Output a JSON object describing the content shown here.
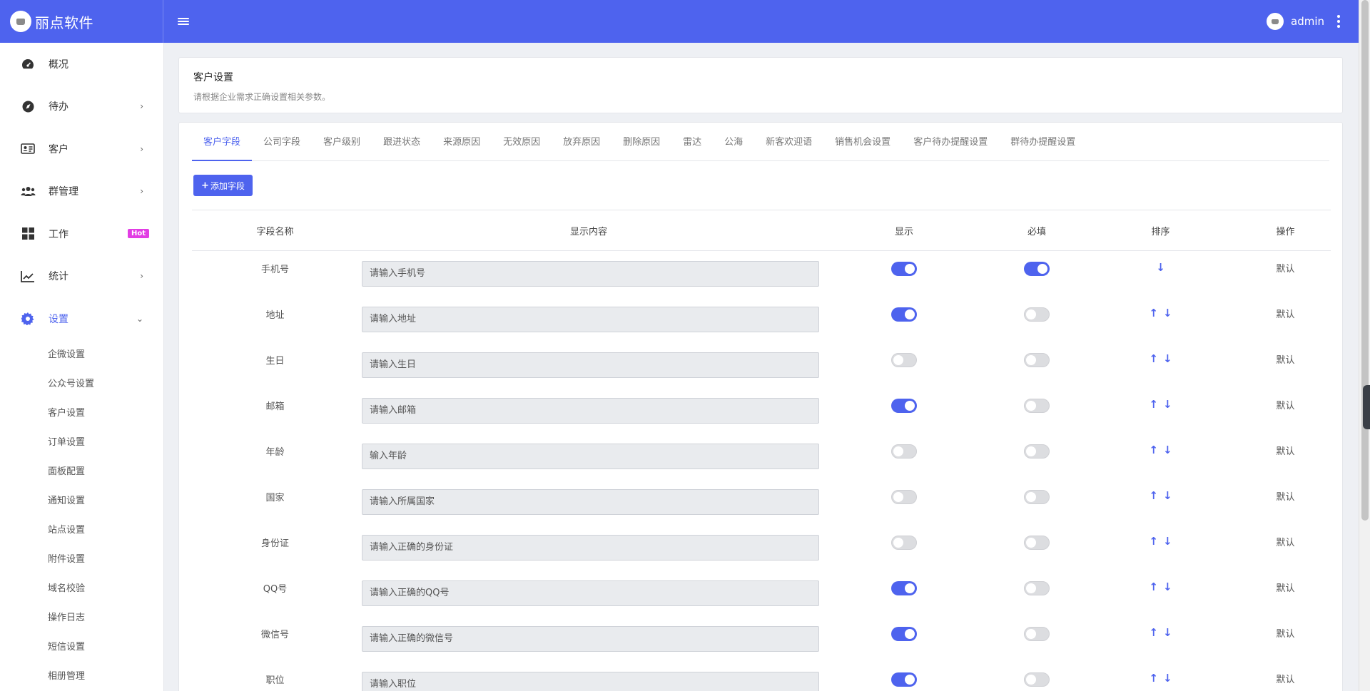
{
  "app": {
    "brand": "丽点软件",
    "username": "admin"
  },
  "colors": {
    "primary": "#4e63ee",
    "hot_badge": "#e23de4"
  },
  "sidebar": {
    "items": [
      {
        "label": "概况",
        "icon": "dashboard-gauge-icon"
      },
      {
        "label": "待办",
        "icon": "compass-icon",
        "arrow": "›"
      },
      {
        "label": "客户",
        "icon": "id-card-icon",
        "arrow": "›"
      },
      {
        "label": "群管理",
        "icon": "users-group-icon",
        "arrow": "›"
      },
      {
        "label": "工作",
        "icon": "grid-icon",
        "badge": "Hot"
      },
      {
        "label": "统计",
        "icon": "line-chart-icon",
        "arrow": "›"
      },
      {
        "label": "设置",
        "icon": "gear-icon",
        "arrow": "⌄",
        "active": true
      }
    ],
    "sub_items": [
      "企微设置",
      "公众号设置",
      "客户设置",
      "订单设置",
      "面板配置",
      "通知设置",
      "站点设置",
      "附件设置",
      "域名校验",
      "操作日志",
      "短信设置",
      "相册管理"
    ]
  },
  "header_card": {
    "title": "客户设置",
    "desc": "请根据企业需求正确设置相关参数。"
  },
  "tabs": [
    "客户字段",
    "公司字段",
    "客户级别",
    "跟进状态",
    "来源原因",
    "无效原因",
    "放弃原因",
    "删除原因",
    "雷达",
    "公海",
    "新客欢迎语",
    "销售机会设置",
    "客户待办提醒设置",
    "群待办提醒设置"
  ],
  "add_button": {
    "plus": "+",
    "label": "添加字段"
  },
  "table": {
    "headers": [
      "字段名称",
      "显示内容",
      "显示",
      "必填",
      "排序",
      "操作"
    ],
    "rows": [
      {
        "name": "手机号",
        "placeholder": "请输入手机号",
        "show": true,
        "required": true,
        "up": false,
        "action": "默认"
      },
      {
        "name": "地址",
        "placeholder": "请输入地址",
        "show": true,
        "required": false,
        "up": true,
        "action": "默认"
      },
      {
        "name": "生日",
        "placeholder": "请输入生日",
        "show": false,
        "required": false,
        "up": true,
        "action": "默认"
      },
      {
        "name": "邮箱",
        "placeholder": "请输入邮箱",
        "show": true,
        "required": false,
        "up": true,
        "action": "默认"
      },
      {
        "name": "年龄",
        "placeholder": "输入年龄",
        "show": false,
        "required": false,
        "up": true,
        "action": "默认"
      },
      {
        "name": "国家",
        "placeholder": "请输入所属国家",
        "show": false,
        "required": false,
        "up": true,
        "action": "默认"
      },
      {
        "name": "身份证",
        "placeholder": "请输入正确的身份证",
        "show": false,
        "required": false,
        "up": true,
        "action": "默认"
      },
      {
        "name": "QQ号",
        "placeholder": "请输入正确的QQ号",
        "show": true,
        "required": false,
        "up": true,
        "action": "默认"
      },
      {
        "name": "微信号",
        "placeholder": "请输入正确的微信号",
        "show": true,
        "required": false,
        "up": true,
        "action": "默认"
      },
      {
        "name": "职位",
        "placeholder": "请输入职位",
        "show": true,
        "required": false,
        "up": true,
        "action": "默认"
      }
    ],
    "sort_up": "↑",
    "sort_down": "↓"
  }
}
